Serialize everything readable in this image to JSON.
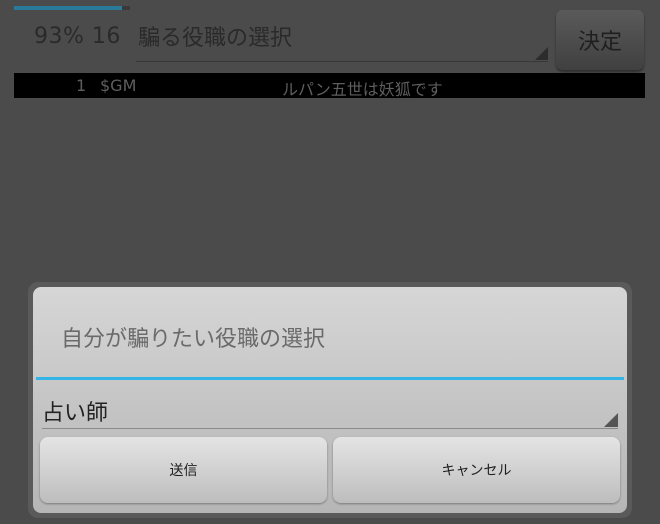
{
  "header": {
    "progress_fraction": 0.93,
    "status_text": "93% 16",
    "role_select_label": "騙る役職の選択",
    "decide_label": "決定"
  },
  "log": {
    "row": {
      "num": "1",
      "sender": "$GM",
      "message": "ルパン五世は妖狐です"
    }
  },
  "dialog": {
    "title": "自分が騙りたい役職の選択",
    "selected_role": "占い師",
    "send_label": "送信",
    "cancel_label": "キャンセル"
  },
  "colors": {
    "accent": "#33b5e5",
    "backdrop": "#4b4b4b",
    "log_bar": "#000000"
  }
}
